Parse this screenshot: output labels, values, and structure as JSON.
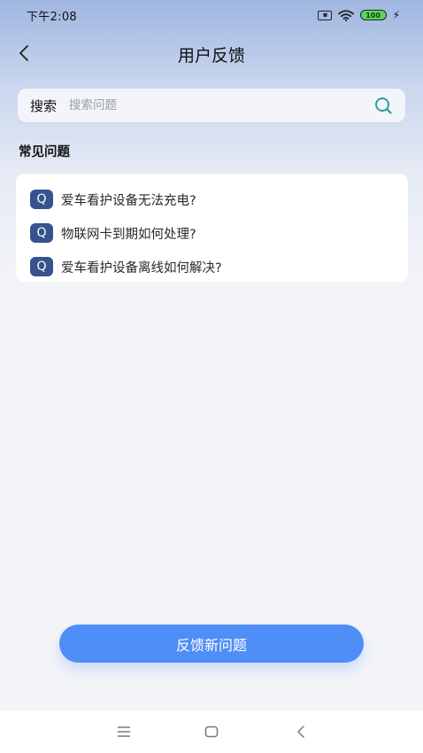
{
  "status_bar": {
    "time": "下午2:08",
    "battery": "100",
    "icons": [
      "sim-off-icon",
      "wifi-icon",
      "battery-icon",
      "charging-icon"
    ]
  },
  "header": {
    "title": "用户反馈",
    "back_icon": "chevron-left-icon"
  },
  "search": {
    "label": "搜索",
    "placeholder": "搜索问题",
    "value": "",
    "icon": "search-icon"
  },
  "faq": {
    "title": "常见问题",
    "badge": "Q",
    "items": [
      {
        "question": "爱车看护设备无法充电?"
      },
      {
        "question": "物联网卡到期如何处理?"
      },
      {
        "question": "爱车看护设备离线如何解决?"
      }
    ]
  },
  "actions": {
    "new_feedback_label": "反馈新问题"
  },
  "colors": {
    "accent": "#4f8df7",
    "badge": "#35538f",
    "search_icon": "#2aa198",
    "background": "#f4f5f8"
  },
  "nav_bar": {
    "icons": [
      "menu-icon",
      "home-icon",
      "back-icon"
    ]
  }
}
